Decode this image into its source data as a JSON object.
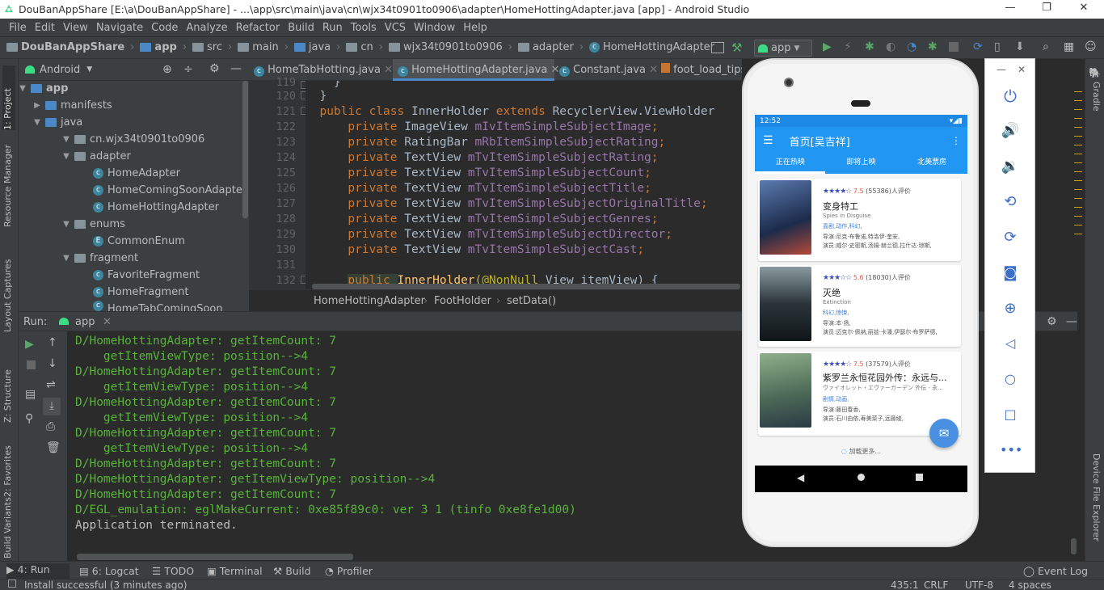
{
  "window": {
    "title": "DouBanAppShare [E:\\a\\DouBanAppShare] - ...\\app\\src\\main\\java\\cn\\wjx34t0901to0906\\adapter\\HomeHottingAdapter.java [app] - Android Studio"
  },
  "menu": [
    "File",
    "Edit",
    "View",
    "Navigate",
    "Code",
    "Analyze",
    "Refactor",
    "Build",
    "Run",
    "Tools",
    "VCS",
    "Window",
    "Help"
  ],
  "nav": {
    "crumbs": [
      "DouBanAppShare",
      "app",
      "src",
      "main",
      "java",
      "cn",
      "wjx34t0901to0906",
      "adapter",
      "HomeHottingAdapter"
    ],
    "run_config": "app"
  },
  "left_strip": [
    "1: Project",
    "Resource Manager",
    "Layout Captures",
    "Z: Structure",
    "2: Favorites",
    "Build Variants"
  ],
  "right_strip": [
    "Gradle",
    "Device File Explorer"
  ],
  "project": {
    "view": "Android",
    "tree": [
      {
        "label": "app",
        "bold": true
      },
      {
        "label": "manifests"
      },
      {
        "label": "java"
      },
      {
        "label": "cn.wjx34t0901to0906"
      },
      {
        "label": "adapter"
      },
      {
        "label": "HomeAdapter"
      },
      {
        "label": "HomeComingSoonAdapter"
      },
      {
        "label": "HomeHottingAdapter"
      },
      {
        "label": "enums"
      },
      {
        "label": "CommonEnum"
      },
      {
        "label": "fragment"
      },
      {
        "label": "FavoriteFragment"
      },
      {
        "label": "HomeFragment"
      },
      {
        "label": "HomeTabComingSoon"
      }
    ]
  },
  "editor": {
    "tabs": [
      "HomeTabHotting.java",
      "HomeHottingAdapter.java",
      "Constant.java",
      "foot_load_tips.x"
    ],
    "line_numbers": [
      "119",
      "120",
      "121",
      "122",
      "123",
      "124",
      "125",
      "126",
      "127",
      "128",
      "129",
      "130",
      "131",
      "132"
    ],
    "code": {
      "l119": "    }",
      "l120": "}",
      "l121_kw": "public class ",
      "l121_name": "InnerHolder ",
      "l121_kw2": "extends ",
      "l121_rest": "RecyclerView.ViewHolder",
      "fields": [
        {
          "type": "ImageView ",
          "name": "mIvItemSimpleSubjectImage"
        },
        {
          "type": "RatingBar ",
          "name": "mRbItemSimpleSubjectRating"
        },
        {
          "type": "TextView ",
          "name": "mTvItemSimpleSubjectRating"
        },
        {
          "type": "TextView ",
          "name": "mTvItemSimpleSubjectCount"
        },
        {
          "type": "TextView ",
          "name": "mTvItemSimpleSubjectTitle"
        },
        {
          "type": "TextView ",
          "name": "mTvItemSimpleSubjectOriginalTitle"
        },
        {
          "type": "TextView ",
          "name": "mTvItemSimpleSubjectGenres"
        },
        {
          "type": "TextView ",
          "name": "mTvItemSimpleSubjectDirector"
        },
        {
          "type": "TextView ",
          "name": "mTvItemSimpleSubjectCast"
        }
      ],
      "private_kw": "private ",
      "semi": ";",
      "l132_kw": "public ",
      "l132_name": "InnerHolder",
      "l132_ann": "(@NonNull ",
      "l132_rest": "View itemView) {"
    },
    "breadcrumb": [
      "HomeHottingAdapter",
      "FootHolder",
      "setData()"
    ]
  },
  "run": {
    "label": "Run:",
    "config": "app",
    "lines": [
      {
        "text": "D/HomeHottingAdapter: getItemCount: 7",
        "style": "g"
      },
      {
        "text": "    getItemViewType: position-->4",
        "style": "g"
      },
      {
        "text": "D/HomeHottingAdapter: getItemCount: 7",
        "style": "g"
      },
      {
        "text": "    getItemViewType: position-->4",
        "style": "g"
      },
      {
        "text": "D/HomeHottingAdapter: getItemCount: 7",
        "style": "g"
      },
      {
        "text": "    getItemViewType: position-->4",
        "style": "g"
      },
      {
        "text": "D/HomeHottingAdapter: getItemCount: 7",
        "style": "g"
      },
      {
        "text": "    getItemViewType: position-->4",
        "style": "g"
      },
      {
        "text": "D/HomeHottingAdapter: getItemCount: 7",
        "style": "g"
      },
      {
        "text": "D/HomeHottingAdapter: getItemViewType: position-->4",
        "style": "g"
      },
      {
        "text": "D/HomeHottingAdapter: getItemCount: 7",
        "style": "g"
      },
      {
        "text": "D/EGL_emulation: eglMakeCurrent: 0xe85f89c0: ver 3 1 (tinfo 0xe8fe1d00)",
        "style": "g"
      },
      {
        "text": "Application terminated.",
        "style": "w"
      }
    ]
  },
  "bottom_tabs": [
    "4: Run",
    "6: Logcat",
    "TODO",
    "Terminal",
    "Build",
    "Profiler",
    "Event Log"
  ],
  "status": {
    "message": "Install successful (3 minutes ago)",
    "position": "435:1",
    "line_sep": "CRLF",
    "encoding": "UTF-8",
    "indent": "4 spaces"
  },
  "phone": {
    "time": "12:52",
    "app_title": "首页[吴吉祥]",
    "tabs": [
      "正在热映",
      "即将上映",
      "北美票房"
    ],
    "movies": [
      {
        "rating": "7.5",
        "count": "(55386)人评价",
        "title": "变身特工",
        "original": "Spies in Disguise",
        "genres": "喜剧,动作,科幻,",
        "director": "导演:尼克·布鲁诺,特洛伊·奎安,",
        "cast": "演员:威尔·史密斯,汤姆·赫兰德,拉什达·琼斯,",
        "stars": 4,
        "poster": "#2d4a7a"
      },
      {
        "rating": "5.6",
        "count": "(18030)人评价",
        "title": "灭绝",
        "original": "Extinction",
        "genres": "科幻,惊悚,",
        "director": "导演:本·扬,",
        "cast": "演员:迈克尔·佩纳,丽兹·卡潘,伊瑟尔·布罗萨德,",
        "stars": 3,
        "poster": "#3b4a4e"
      },
      {
        "rating": "7.5",
        "count": "(37579)人评价",
        "title": "紫罗兰永恒花园外传：永远与...",
        "original": "ヴァイオレット・エヴァーガーデン 外伝 - 永...",
        "genres": "剧情,动画,",
        "director": "导演:藤田春香,",
        "cast": "演员:石川由依,寿美菜子,远藤绫,",
        "stars": 4,
        "poster": "#6b7d5a"
      }
    ],
    "loading": "加载更多..."
  },
  "colors": {
    "accent": "#2196f3",
    "console_green": "#58b33a",
    "keyword": "#cc7832",
    "field": "#9876aa"
  }
}
